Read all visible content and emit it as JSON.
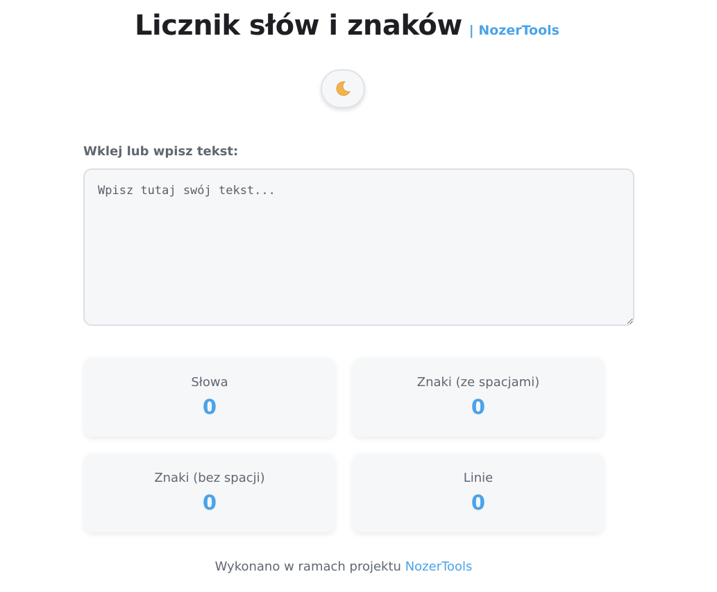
{
  "header": {
    "title": "Licznik słów i znaków",
    "brand": "| NozerTools"
  },
  "theme_toggle": {
    "icon": "crescent-moon-icon",
    "icon_color": "#f2b54a"
  },
  "input": {
    "label": "Wklej lub wpisz tekst:",
    "value": "",
    "placeholder": "Wpisz tutaj swój tekst..."
  },
  "stats": [
    {
      "label": "Słowa",
      "value": "0"
    },
    {
      "label": "Znaki (ze spacjami)",
      "value": "0"
    },
    {
      "label": "Znaki (bez spacji)",
      "value": "0"
    },
    {
      "label": "Linie",
      "value": "0"
    }
  ],
  "footer": {
    "text": "Wykonano w ramach projektu",
    "link_label": "NozerTools"
  },
  "colors": {
    "accent": "#4aa3ea",
    "text_dark": "#1f1f23",
    "text_muted": "#5f6770",
    "card_bg": "#f6f7f9"
  }
}
